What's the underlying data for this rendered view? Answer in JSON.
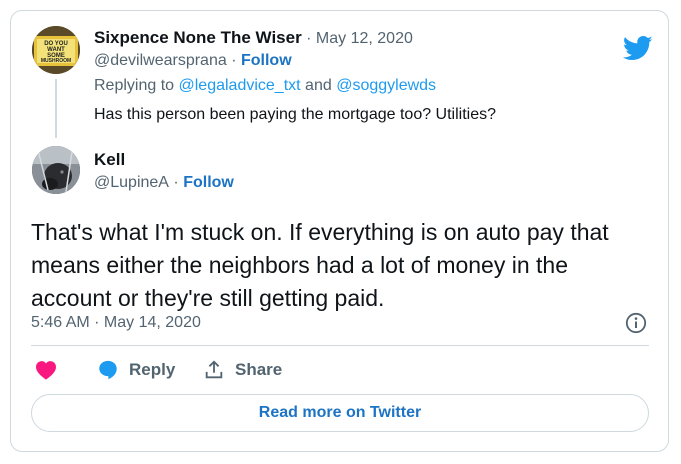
{
  "parent_tweet": {
    "avatar_text": [
      "DO YOU",
      "WANT",
      "SOME",
      "MUSHROOM"
    ],
    "author_name": "Sixpence None The Wiser",
    "date": "May 12, 2020",
    "handle": "@devilwearsprana",
    "follow_label": "Follow",
    "replying_prefix": "Replying to",
    "replying_to_1": "@legaladvice_txt",
    "replying_and": "and",
    "replying_to_2": "@soggylewds",
    "text": "Has this person been paying the mortgage too? Utilities?"
  },
  "main_tweet": {
    "author_name": "Kell",
    "handle": "@LupineA",
    "follow_label": "Follow",
    "text": "That's what I'm stuck on. If everything is on auto pay that means either the neighbors had a lot of money in the account or they're still getting paid.",
    "timestamp": "5:46 AM · May 14, 2020"
  },
  "actions": {
    "reply_label": "Reply",
    "share_label": "Share"
  },
  "read_more_label": "Read more on Twitter",
  "colors": {
    "link_blue": "#1d9bf0",
    "follow_blue": "#1d74c4",
    "like_pink": "#f91880",
    "muted_gray": "#536471",
    "border": "#cfd9de"
  },
  "icons": [
    "twitter-logo-icon",
    "info-icon",
    "heart-icon",
    "reply-bubble-icon",
    "share-icon"
  ]
}
